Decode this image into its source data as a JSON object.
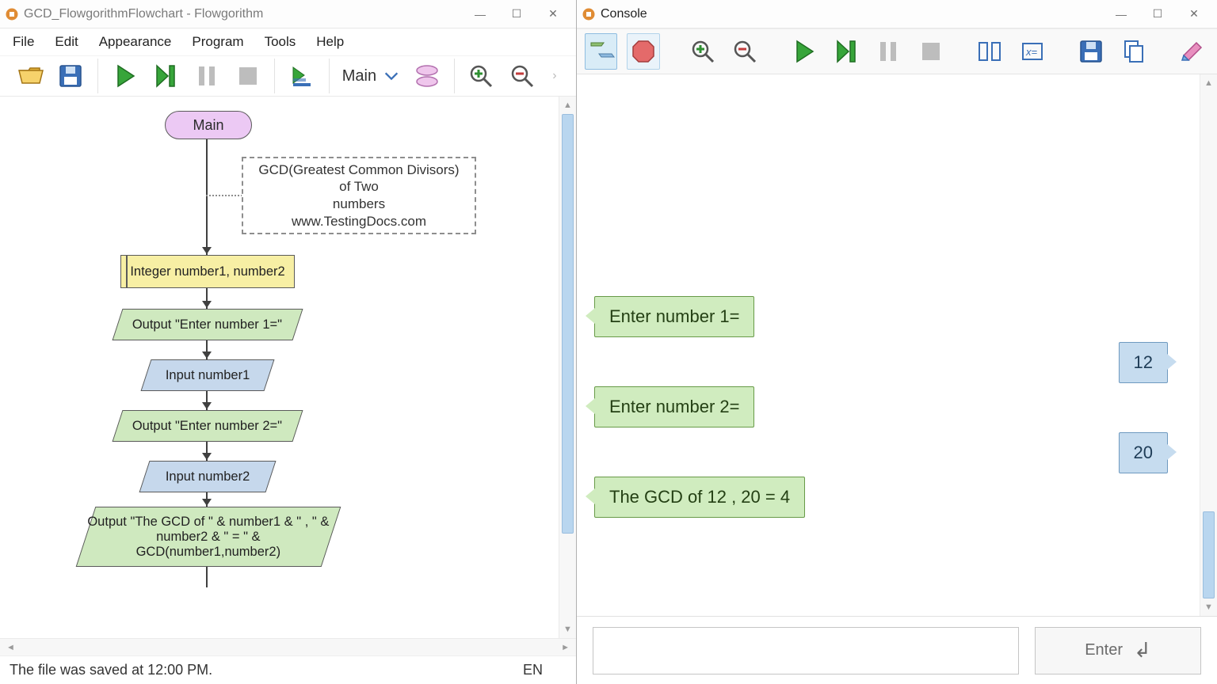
{
  "editor": {
    "title": "GCD_FlowgorithmFlowchart - Flowgorithm",
    "menus": [
      "File",
      "Edit",
      "Appearance",
      "Program",
      "Tools",
      "Help"
    ],
    "function_name": "Main",
    "status": "The file was saved at 12:00 PM.",
    "language_indicator": "EN"
  },
  "flowchart": {
    "terminator": "Main",
    "comment": "GCD(Greatest Common Divisors) of Two\nnumbers\nwww.TestingDocs.com",
    "declare": "Integer number1, number2",
    "output1": "Output \"Enter number 1=\"",
    "input1": "Input number1",
    "output2": "Output \"Enter number 2=\"",
    "input2": "Input number2",
    "output3": "Output \"The GCD of \" & number1 & \" , \" & number2 & \" = \" & GCD(number1,number2)"
  },
  "console": {
    "title": "Console",
    "messages": [
      {
        "kind": "out",
        "text": "Enter number 1="
      },
      {
        "kind": "in",
        "text": "12"
      },
      {
        "kind": "out",
        "text": "Enter number 2="
      },
      {
        "kind": "in",
        "text": "20"
      },
      {
        "kind": "out",
        "text": "The GCD of 12 , 20 = 4"
      }
    ],
    "enter_label": "Enter",
    "input_value": ""
  }
}
